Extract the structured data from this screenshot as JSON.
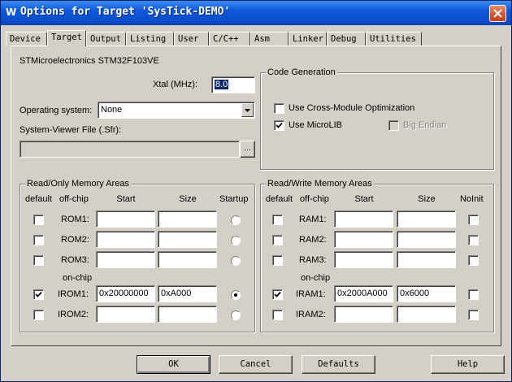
{
  "window": {
    "title": "Options for Target 'SysTick-DEMO'",
    "icon_glyph": "W"
  },
  "tabs": [
    {
      "label": "Device",
      "active": false
    },
    {
      "label": "Target",
      "active": true
    },
    {
      "label": "Output",
      "active": false
    },
    {
      "label": "Listing",
      "active": false
    },
    {
      "label": "User",
      "active": false
    },
    {
      "label": "C/C++",
      "active": false
    },
    {
      "label": "Asm",
      "active": false
    },
    {
      "label": "Linker",
      "active": false
    },
    {
      "label": "Debug",
      "active": false
    },
    {
      "label": "Utilities",
      "active": false
    }
  ],
  "device_name": "STMicroelectronics STM32F103VE",
  "xtal": {
    "label": "Xtal (MHz):",
    "value": "8.0"
  },
  "os": {
    "label": "Operating system:",
    "value": "None"
  },
  "svd": {
    "label": "System-Viewer File (.Sfr):",
    "value": "",
    "browse": "..."
  },
  "codegen": {
    "title": "Code Generation",
    "cross_module": {
      "label": "Use Cross-Module Optimization",
      "checked": false
    },
    "microlib": {
      "label": "Use MicroLIB",
      "checked": true
    },
    "big_endian": {
      "label": "Big Endian",
      "checked": false,
      "enabled": false
    }
  },
  "rom_group": {
    "title": "Read/Only Memory Areas",
    "headers": {
      "default": "default",
      "offchip": "off-chip",
      "start": "Start",
      "size": "Size",
      "startup": "Startup"
    },
    "onchip_label": "on-chip",
    "rows": [
      {
        "name": "ROM1:",
        "default": false,
        "start": "",
        "size": "",
        "startup": false
      },
      {
        "name": "ROM2:",
        "default": false,
        "start": "",
        "size": "",
        "startup": false
      },
      {
        "name": "ROM3:",
        "default": false,
        "start": "",
        "size": "",
        "startup": false
      },
      {
        "name": "IROM1:",
        "default": true,
        "start": "0x20000000",
        "size": "0xA000",
        "startup": true
      },
      {
        "name": "IROM2:",
        "default": false,
        "start": "",
        "size": "",
        "startup": false
      }
    ]
  },
  "ram_group": {
    "title": "Read/Write Memory Areas",
    "headers": {
      "default": "default",
      "offchip": "off-chip",
      "start": "Start",
      "size": "Size",
      "noinit": "NoInit"
    },
    "onchip_label": "on-chip",
    "rows": [
      {
        "name": "RAM1:",
        "default": false,
        "start": "",
        "size": "",
        "noinit": false
      },
      {
        "name": "RAM2:",
        "default": false,
        "start": "",
        "size": "",
        "noinit": false
      },
      {
        "name": "RAM3:",
        "default": false,
        "start": "",
        "size": "",
        "noinit": false
      },
      {
        "name": "IRAM1:",
        "default": true,
        "start": "0x2000A000",
        "size": "0x6000",
        "noinit": false
      },
      {
        "name": "IRAM2:",
        "default": false,
        "start": "",
        "size": "",
        "noinit": false
      }
    ]
  },
  "buttons": {
    "ok": "OK",
    "cancel": "Cancel",
    "defaults": "Defaults",
    "help": "Help"
  },
  "colors": {
    "title_bar": "#0a4bc9",
    "selection": "#0a246a",
    "dialog_bg": "#d4d0c8",
    "close_button": "#d9502c"
  }
}
